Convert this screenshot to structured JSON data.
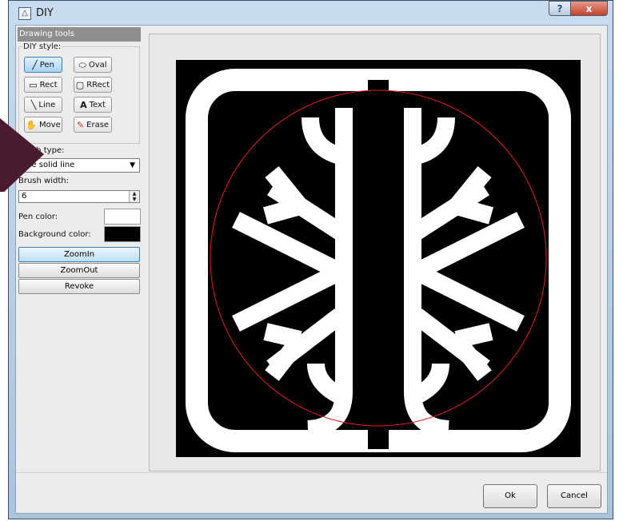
{
  "window": {
    "title": "DIY",
    "icon": "triangle-app-icon",
    "help_label": "?",
    "close_label": "x"
  },
  "left_panel": {
    "header": "Drawing tools",
    "group_title": "DIY style:",
    "tools": [
      {
        "label": "Pen",
        "icon": "pen-icon",
        "glyph": "╱"
      },
      {
        "label": "Oval",
        "icon": "oval-icon",
        "glyph": "⬭"
      },
      {
        "label": "Rect",
        "icon": "rect-icon",
        "glyph": "▭"
      },
      {
        "label": "RRect",
        "icon": "rounded-rect-icon",
        "glyph": "▢"
      },
      {
        "label": "Line",
        "icon": "line-icon",
        "glyph": "╲"
      },
      {
        "label": "Text",
        "icon": "text-icon",
        "glyph": "A"
      },
      {
        "label": "Move",
        "icon": "hand-icon",
        "glyph": "✋"
      },
      {
        "label": "Erase",
        "icon": "eraser-icon",
        "glyph": "✎"
      }
    ],
    "brush_type_label": "sh type:",
    "brush_type_value": "The solid line",
    "brush_width_label": "Brush width:",
    "brush_width_value": "6",
    "pen_color_label": "Pen color:",
    "pen_color": "#ffffff",
    "bg_color_label": "Background color:",
    "bg_color": "#000000",
    "zoom_in_label": "ZoomIn",
    "zoom_out_label": "ZoomOut",
    "revoke_label": "Revoke"
  },
  "dialog": {
    "ok_label": "Ok",
    "cancel_label": "Cancel"
  },
  "colors": {
    "accent": "#3c7fb1",
    "frame": "#aac3df",
    "overlay_arrow": "#4a1a2e",
    "circle": "#e02020"
  }
}
